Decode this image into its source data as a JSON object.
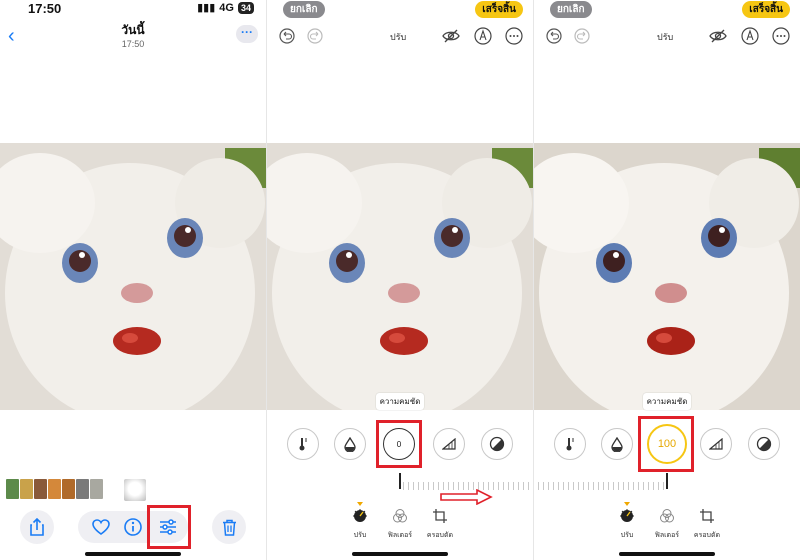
{
  "panel1": {
    "status": {
      "time": "17:50",
      "signal": "4G",
      "battery": "34"
    },
    "title": "วันนี้",
    "subtitle": "17:50",
    "more_label": "···"
  },
  "panel2": {
    "cancel": "ยกเลิก",
    "done": "เสร็จสิ้น",
    "mode": "ปรับ",
    "param_label": "ความคมชัด",
    "value": "0",
    "tabs": [
      "ปรับ",
      "ฟิลเตอร์",
      "ครอบตัด"
    ]
  },
  "panel3": {
    "cancel": "ยกเลิก",
    "done": "เสร็จสิ้น",
    "mode": "ปรับ",
    "param_label": "ความคมชัด",
    "value": "100",
    "tabs": [
      "ปรับ",
      "ฟิลเตอร์",
      "ครอบตัด"
    ]
  },
  "colors": {
    "accent_blue": "#1a7cf5",
    "done_yellow": "#f6c613",
    "highlight_red": "#e0212a"
  },
  "icons": [
    "back-chevron-icon",
    "share-icon",
    "heart-icon",
    "info-icon",
    "adjust-sliders-icon",
    "trash-icon",
    "undo-icon",
    "redo-icon",
    "hide-icon",
    "markup-icon",
    "more-icon",
    "thermometer-icon",
    "drop-icon",
    "triangle-icon",
    "contrast-icon",
    "adjust-dial-icon",
    "filters-icon",
    "crop-icon"
  ]
}
